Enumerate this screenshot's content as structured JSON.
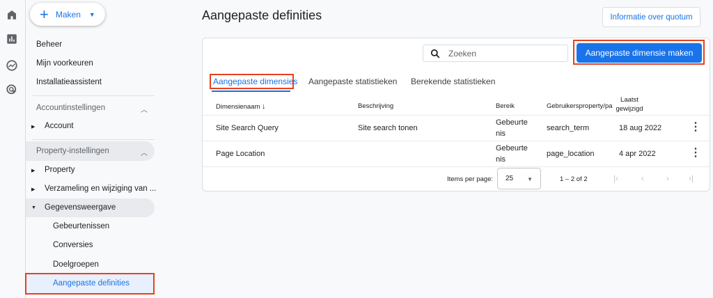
{
  "rail": {
    "icons": [
      "home-icon",
      "reports-icon",
      "explore-icon",
      "advertising-icon"
    ]
  },
  "sidebar": {
    "create_label": "Maken",
    "top_items": [
      "Beheer",
      "Mijn voorkeuren",
      "Installatieassistent"
    ],
    "account_section": "Accountinstellingen",
    "account_item": "Account",
    "property_section": "Property-instellingen",
    "property_items": [
      "Property",
      "Verzameling en wijziging van ...",
      "Gegevensweergave"
    ],
    "sub_items": [
      "Gebeurtenissen",
      "Conversies",
      "Doelgroepen",
      "Aangepaste definities"
    ],
    "active_item": "Aangepaste definities"
  },
  "header": {
    "title": "Aangepaste definities",
    "quota_button": "Informatie over quotum"
  },
  "toolbar": {
    "search_placeholder": "Zoeken",
    "create_button": "Aangepaste dimensie maken"
  },
  "tabs": [
    {
      "label": "Aangepaste dimensies",
      "active": true
    },
    {
      "label": "Aangepaste statistieken"
    },
    {
      "label": "Berekende statistieken"
    }
  ],
  "table": {
    "columns": [
      "Dimensienaam",
      "Beschrijving",
      "Bereik",
      "Gebruikersproperty/pa",
      "Laatst gewijzigd"
    ],
    "sort_column": "Dimensienaam",
    "sort_direction": "descending",
    "rows": [
      {
        "name": "Site Search Query",
        "description": "Site search tonen",
        "scope": "Gebeurtenis",
        "param": "search_term",
        "modified": "18 aug 2022"
      },
      {
        "name": "Page Location",
        "description": "",
        "scope": "Gebeurtenis",
        "param": "page_location",
        "modified": "4 apr 2022"
      }
    ]
  },
  "pagination": {
    "items_per_page_label": "Items per page:",
    "items_per_page": "25",
    "range": "1 – 2 of 2"
  },
  "colors": {
    "accent": "#1a73e8",
    "highlight": "#e8401c"
  }
}
